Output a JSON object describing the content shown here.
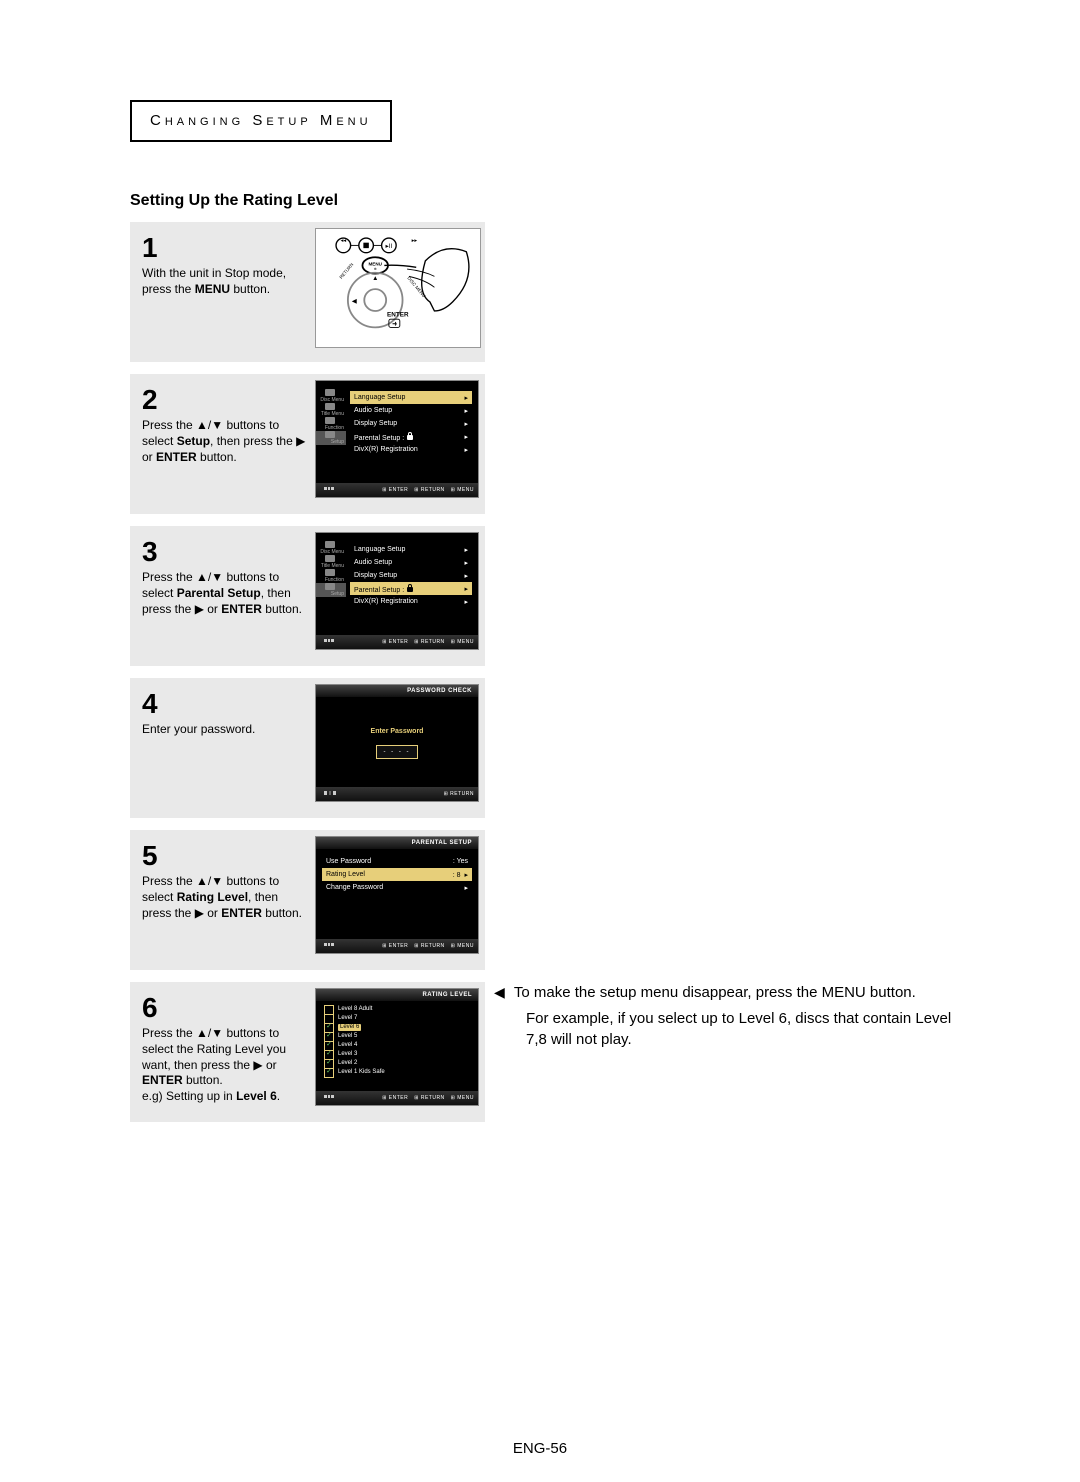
{
  "header": {
    "title": "Changing Setup Menu"
  },
  "subtitle": "Setting Up the Rating Level",
  "steps": {
    "s1": {
      "num": "1",
      "text_a": "With the unit in Stop mode, press the ",
      "bold": "MENU",
      "text_b": " button.",
      "enter_label": "ENTER"
    },
    "s2": {
      "num": "2",
      "text_a": "Press the ▲/▼ buttons to select ",
      "bold": "Setup",
      "text_b": ", then press the ▶ or ",
      "bold2": "ENTER",
      "text_c": " button."
    },
    "s3": {
      "num": "3",
      "text_a": "Press the ▲/▼ buttons to select ",
      "bold": "Parental Setup",
      "text_b": ", then press the ▶ or ",
      "bold2": "ENTER",
      "text_c": " button."
    },
    "s4": {
      "num": "4",
      "text_a": "Enter your password."
    },
    "s5": {
      "num": "5",
      "text_a": "Press the ▲/▼ buttons to select ",
      "bold": "Rating Level",
      "text_b": ", then press the ▶ or ",
      "bold2": "ENTER",
      "text_c": " button."
    },
    "s6": {
      "num": "6",
      "text_a": "Press the ▲/▼ buttons to select the Rating Level you want, then press the ▶ or ",
      "bold": "ENTER",
      "text_b": " button.",
      "eg_a": "e.g) Setting up in ",
      "eg_bold": "Level 6",
      "eg_b": "."
    }
  },
  "osd": {
    "sidebar": {
      "item1": "Disc Menu",
      "item2": "Title Menu",
      "item3": "Function",
      "item4": "Setup"
    },
    "setupMenu": {
      "items": [
        {
          "label": "Language Setup"
        },
        {
          "label": "Audio Setup"
        },
        {
          "label": "Display Setup"
        },
        {
          "label": "Parental Setup   :",
          "lock": true
        },
        {
          "label": "DivX(R) Registration"
        }
      ]
    },
    "footer": {
      "enter": "ENTER",
      "return": "RETURN",
      "menu": "MENU"
    },
    "pw": {
      "header": "PASSWORD CHECK",
      "label": "Enter Password",
      "mask": "- - - -",
      "return": "RETURN"
    },
    "parental": {
      "header": "PARENTAL SETUP",
      "rows": [
        {
          "label": "Use Password",
          "val_label": ": Yes"
        },
        {
          "label": "Rating Level",
          "val_label": ": 8",
          "highlight": true
        },
        {
          "label": "Change Password",
          "val_label": ""
        }
      ]
    },
    "rating": {
      "header": "RATING LEVEL",
      "levels": [
        {
          "label": "Level 8 Adult",
          "checked": false
        },
        {
          "label": "Level 7",
          "checked": false
        },
        {
          "label": "Level 6",
          "checked": true,
          "highlight": true
        },
        {
          "label": "Level 5",
          "checked": true
        },
        {
          "label": "Level 4",
          "checked": true
        },
        {
          "label": "Level 3",
          "checked": true
        },
        {
          "label": "Level 2",
          "checked": true
        },
        {
          "label": "Level 1 Kids Safe",
          "checked": true
        }
      ]
    }
  },
  "notes": {
    "n1": "To make the setup menu disappear, press the MENU button.",
    "n2": "For example, if you select up to Level 6, discs that contain Level 7,8 will not play."
  },
  "pageNum": "ENG-56"
}
